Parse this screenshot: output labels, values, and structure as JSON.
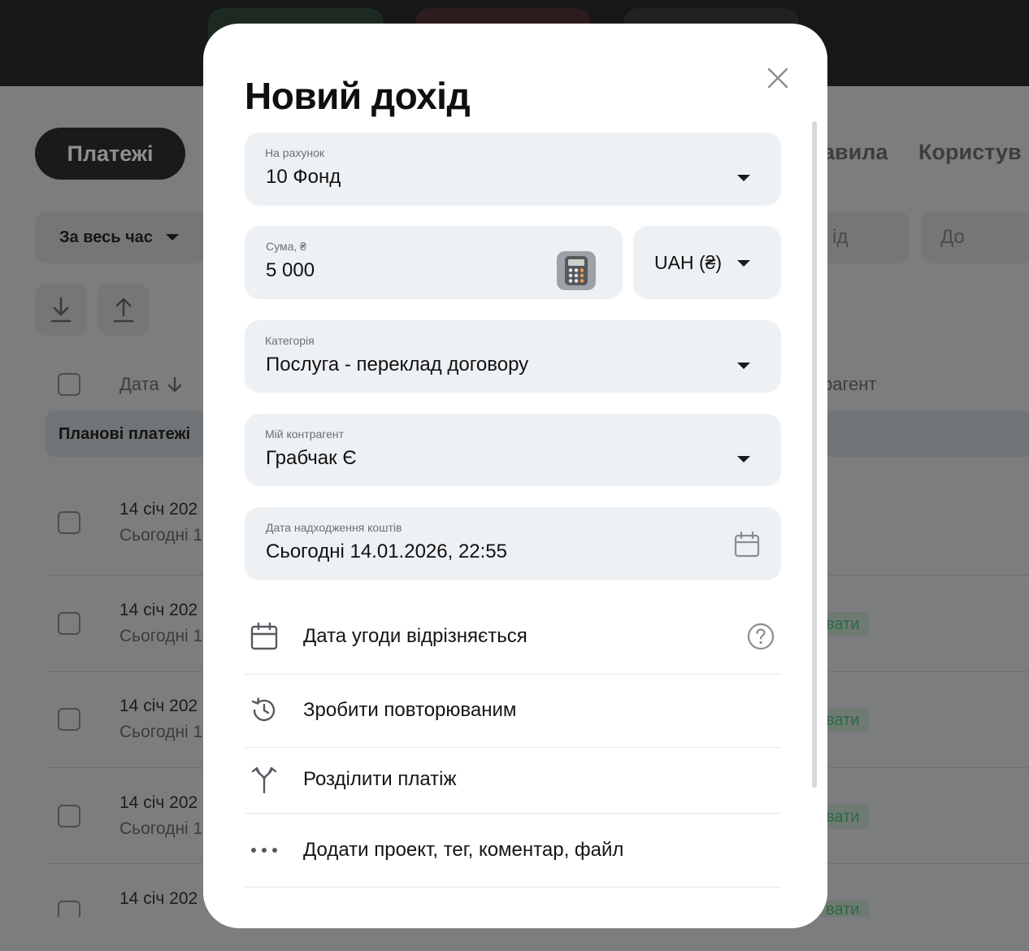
{
  "background": {
    "tabs": [
      "Платежі",
      "авила",
      "Користув"
    ],
    "period_filter": "За весь час",
    "from_placeholder": "ід",
    "to_placeholder": "До",
    "columns": {
      "date": "Дата",
      "counterparty": "рагент"
    },
    "group_label": "Планові платежі",
    "rows": [
      {
        "date": "14 січ 202",
        "sub": "Сьогодні 1",
        "badge": ""
      },
      {
        "date": "14 січ 202",
        "sub": "Сьогодні 1",
        "badge": "вати"
      },
      {
        "date": "14 січ 202",
        "sub": "Сьогодні 1",
        "badge": "вати"
      },
      {
        "date": "14 січ 202",
        "sub": "Сьогодні 1",
        "badge": "вати"
      },
      {
        "date": "14 січ 202",
        "sub": "",
        "badge": "вати"
      }
    ]
  },
  "modal": {
    "title": "Новий дохід",
    "account": {
      "label": "На рахунок",
      "value": "10 Фонд"
    },
    "amount": {
      "label": "Сума, ₴",
      "value": "5 000"
    },
    "currency": {
      "value": "UAH (₴)"
    },
    "category": {
      "label": "Категорія",
      "value": "Послуга - переклад договору"
    },
    "counterparty": {
      "label": "Мій контрагент",
      "value": "Грабчак Є"
    },
    "received_date": {
      "label": "Дата надходження коштів",
      "value": "Сьогодні 14.01.2026, 22:55"
    },
    "options": [
      {
        "label": "Дата угоди відрізняється",
        "icon": "calendar-icon"
      },
      {
        "label": "Зробити повторюваним",
        "icon": "history-icon"
      },
      {
        "label": "Розділити платіж",
        "icon": "split-icon"
      },
      {
        "label": "Додати проект, тег, коментар, файл",
        "icon": "more-icon"
      }
    ]
  },
  "colors": {
    "field_bg": "#eef1f4",
    "overlay_bg": "#7b7d7f",
    "topbar_bg": "#161718",
    "badge_text": "#2c6a45"
  }
}
